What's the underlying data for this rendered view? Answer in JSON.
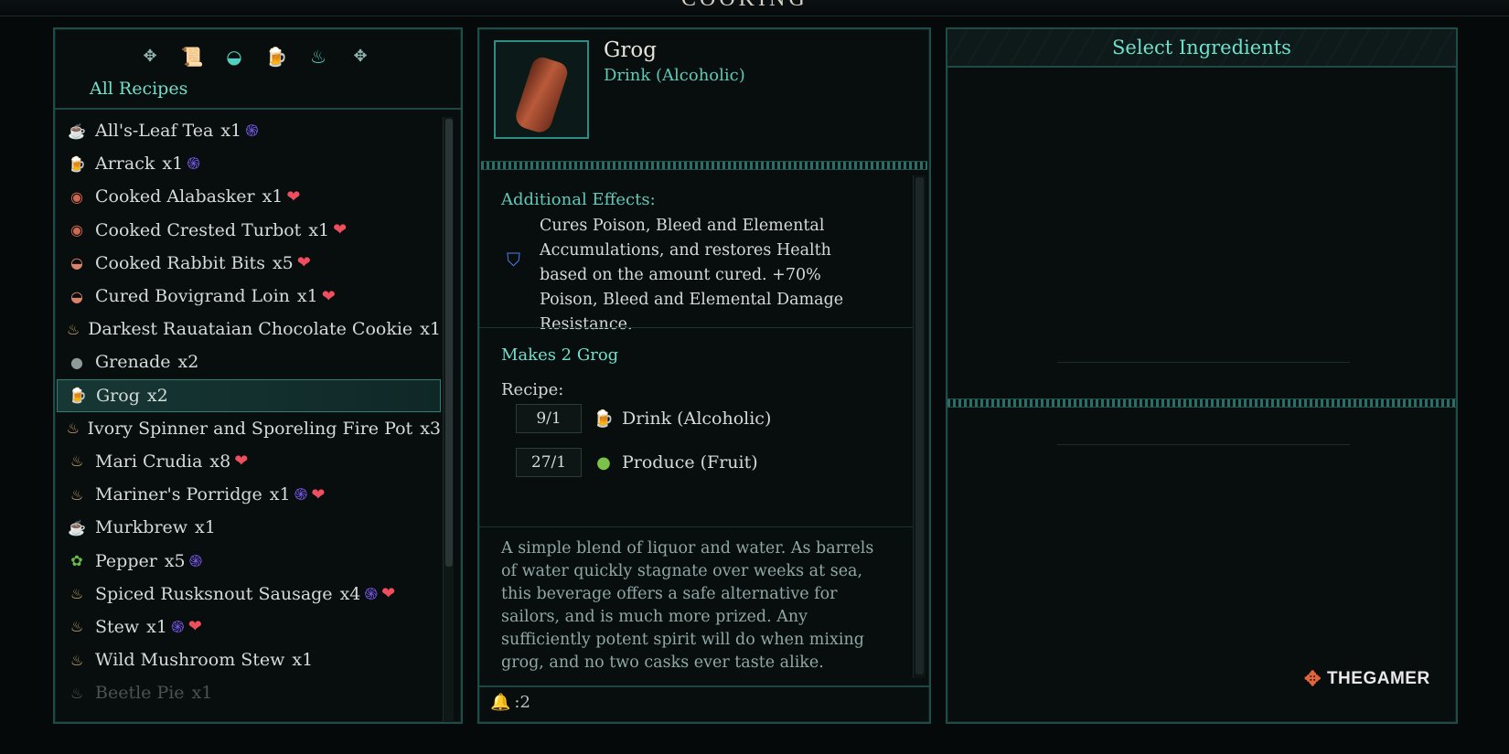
{
  "header": {
    "title": "COOKING"
  },
  "left_panel": {
    "category_icons": [
      "diamond-left-icon",
      "scroll-icon",
      "meat-icon",
      "mug-icon",
      "bowl-icon",
      "diamond-right-icon"
    ],
    "filter_label": "All Recipes",
    "recipes": [
      {
        "icon": "cup-icon",
        "glyph": "☕",
        "color": "#9cc4f0",
        "name": "All's-Leaf Tea",
        "qty": "x1",
        "buffs": [
          "swirl"
        ]
      },
      {
        "icon": "mug-icon",
        "glyph": "🍺",
        "color": "#e8c14a",
        "name": "Arrack",
        "qty": "x1",
        "buffs": [
          "swirl"
        ]
      },
      {
        "icon": "fish-icon",
        "glyph": "◉",
        "color": "#d06850",
        "name": "Cooked Alabasker",
        "qty": "x1",
        "buffs": [
          "heart"
        ]
      },
      {
        "icon": "fish-icon",
        "glyph": "◉",
        "color": "#d06850",
        "name": "Cooked Crested Turbot",
        "qty": "x1",
        "buffs": [
          "heart"
        ]
      },
      {
        "icon": "meat-icon",
        "glyph": "◒",
        "color": "#d9826c",
        "name": "Cooked Rabbit Bits",
        "qty": "x5",
        "buffs": [
          "heart"
        ]
      },
      {
        "icon": "meat-icon",
        "glyph": "◒",
        "color": "#d9826c",
        "name": "Cured Bovigrand Loin",
        "qty": "x1",
        "buffs": [
          "heart"
        ]
      },
      {
        "icon": "bowl-icon",
        "glyph": "♨",
        "color": "#c9a76a",
        "name": "Darkest Rauataian Chocolate Cookie",
        "qty": "x1",
        "buffs": []
      },
      {
        "icon": "grenade-icon",
        "glyph": "●",
        "color": "#8e9a9a",
        "name": "Grenade",
        "qty": "x2",
        "buffs": []
      },
      {
        "icon": "mug-icon",
        "glyph": "🍺",
        "color": "#e8c14a",
        "name": "Grog",
        "qty": "x2",
        "buffs": [],
        "selected": true
      },
      {
        "icon": "bowl-icon",
        "glyph": "♨",
        "color": "#c9a76a",
        "name": "Ivory Spinner and Sporeling Fire Pot",
        "qty": "x3",
        "buffs": []
      },
      {
        "icon": "bowl-icon",
        "glyph": "♨",
        "color": "#c9a76a",
        "name": "Mari Crudia",
        "qty": "x8",
        "buffs": [
          "heart"
        ]
      },
      {
        "icon": "bowl-icon",
        "glyph": "♨",
        "color": "#c9a76a",
        "name": "Mariner's Porridge",
        "qty": "x1",
        "buffs": [
          "swirl",
          "heart"
        ]
      },
      {
        "icon": "cup-icon",
        "glyph": "☕",
        "color": "#9cc4f0",
        "name": "Murkbrew",
        "qty": "x1",
        "buffs": []
      },
      {
        "icon": "pepper-icon",
        "glyph": "✿",
        "color": "#6bbb4a",
        "name": "Pepper",
        "qty": "x5",
        "buffs": [
          "swirl"
        ]
      },
      {
        "icon": "bowl-icon",
        "glyph": "♨",
        "color": "#c9a76a",
        "name": "Spiced Rusksnout Sausage",
        "qty": "x4",
        "buffs": [
          "swirl",
          "heart"
        ]
      },
      {
        "icon": "bowl-icon",
        "glyph": "♨",
        "color": "#c9a76a",
        "name": "Stew",
        "qty": "x1",
        "buffs": [
          "swirl",
          "heart"
        ]
      },
      {
        "icon": "bowl-icon",
        "glyph": "♨",
        "color": "#c9a76a",
        "name": "Wild Mushroom Stew",
        "qty": "x1",
        "buffs": []
      },
      {
        "icon": "bowl-icon",
        "glyph": "♨",
        "color": "#555c5b",
        "name": "Beetle Pie",
        "qty": "x1",
        "buffs": [],
        "faded": true
      }
    ]
  },
  "detail": {
    "item_name": "Grog",
    "item_type": "Drink (Alcoholic)",
    "effects_label": "Additional Effects:",
    "effects_text": "Cures Poison, Bleed and Elemental Accumulations, and restores Health based on the amount cured. +70% Poison, Bleed and Elemental Damage Resistance.",
    "makes_label": "Makes 2 Grog",
    "recipe_label": "Recipe:",
    "ingredients": [
      {
        "count": "9/1",
        "icon": "mug-icon",
        "glyph": "🍺",
        "color": "#e8c14a",
        "name": "Drink (Alcoholic)"
      },
      {
        "count": "27/1",
        "icon": "apple-icon",
        "glyph": "●",
        "color": "#7cc24a",
        "name": "Produce (Fruit)"
      }
    ],
    "description": "A simple blend of liquor and water. As barrels of water quickly stagnate over weeks at sea, this beverage offers a safe alternative for sailors, and is much more prized. Any sufficiently potent spirit will do when mixing grog, and no two casks ever taste alike.",
    "bottom_stat": ":2"
  },
  "right_panel": {
    "title": "Select Ingredients"
  },
  "watermark": {
    "text": "THEGAMER"
  },
  "colors": {
    "accent": "#6fe0cc",
    "border": "#1f4c49",
    "swirl": "#7a5cf0",
    "heart": "#ee4e5e"
  }
}
